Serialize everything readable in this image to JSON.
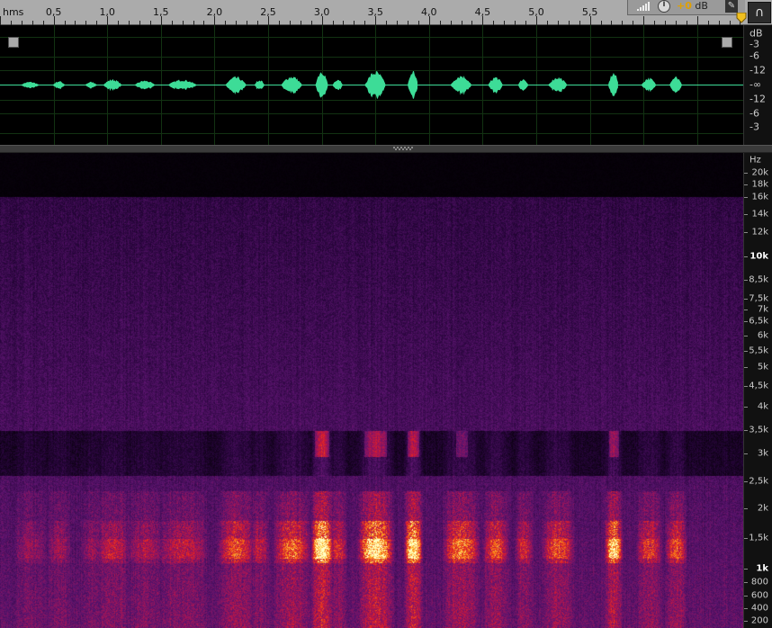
{
  "ruler": {
    "unit": "hms",
    "labels": [
      "0,5",
      "1,0",
      "1,5",
      "2,0",
      "2,5",
      "3,0",
      "3,5",
      "4,0",
      "4,5",
      "5,0",
      "5,5"
    ],
    "label_seconds": [
      0.5,
      1.0,
      1.5,
      2.0,
      2.5,
      3.0,
      3.5,
      4.0,
      4.5,
      5.0,
      5.5
    ],
    "range_seconds": [
      0,
      6.9
    ]
  },
  "controls": {
    "volume_plus": "+0",
    "volume_unit": "dB",
    "pin_glyph": "✎",
    "headphones_glyph": "∩"
  },
  "waveform": {
    "scale_labels": [
      "dB",
      "-3",
      "-6",
      "-12",
      "-12",
      "-6",
      "-3"
    ],
    "center_label": "-∞",
    "color": "#3ddc97",
    "bursts": [
      {
        "t": 0.28,
        "w": 0.18,
        "a": 0.18
      },
      {
        "t": 0.55,
        "w": 0.12,
        "a": 0.22
      },
      {
        "t": 0.85,
        "w": 0.12,
        "a": 0.18
      },
      {
        "t": 1.05,
        "w": 0.18,
        "a": 0.32
      },
      {
        "t": 1.35,
        "w": 0.2,
        "a": 0.25
      },
      {
        "t": 1.7,
        "w": 0.28,
        "a": 0.3
      },
      {
        "t": 2.2,
        "w": 0.2,
        "a": 0.45
      },
      {
        "t": 2.42,
        "w": 0.1,
        "a": 0.3
      },
      {
        "t": 2.72,
        "w": 0.2,
        "a": 0.5
      },
      {
        "t": 3.0,
        "w": 0.12,
        "a": 0.85
      },
      {
        "t": 3.15,
        "w": 0.1,
        "a": 0.35
      },
      {
        "t": 3.5,
        "w": 0.2,
        "a": 0.75
      },
      {
        "t": 3.85,
        "w": 0.1,
        "a": 0.8
      },
      {
        "t": 4.3,
        "w": 0.2,
        "a": 0.55
      },
      {
        "t": 4.62,
        "w": 0.14,
        "a": 0.45
      },
      {
        "t": 4.88,
        "w": 0.1,
        "a": 0.35
      },
      {
        "t": 5.2,
        "w": 0.18,
        "a": 0.45
      },
      {
        "t": 5.72,
        "w": 0.1,
        "a": 0.7
      },
      {
        "t": 6.05,
        "w": 0.14,
        "a": 0.4
      },
      {
        "t": 6.3,
        "w": 0.12,
        "a": 0.45
      }
    ]
  },
  "spectrogram": {
    "scale_title": "Hz",
    "labels": [
      "20k",
      "18k",
      "16k",
      "14k",
      "12k",
      "10k",
      "8,5k",
      "7,5k",
      "7k",
      "6,5k",
      "6k",
      "5,5k",
      "5k",
      "4,5k",
      "4k",
      "3,5k",
      "3k",
      "2,5k",
      "2k",
      "1,5k",
      "1k",
      "800",
      "600",
      "400",
      "200"
    ],
    "label_hz": [
      20000,
      18000,
      16000,
      14000,
      12000,
      10000,
      8500,
      7500,
      7000,
      6500,
      6000,
      5500,
      5000,
      4500,
      4000,
      3500,
      3000,
      2500,
      2000,
      1500,
      1000,
      800,
      600,
      400,
      200
    ],
    "major_labels": [
      "10k",
      "1k"
    ],
    "cutoff_hz": 16000
  }
}
